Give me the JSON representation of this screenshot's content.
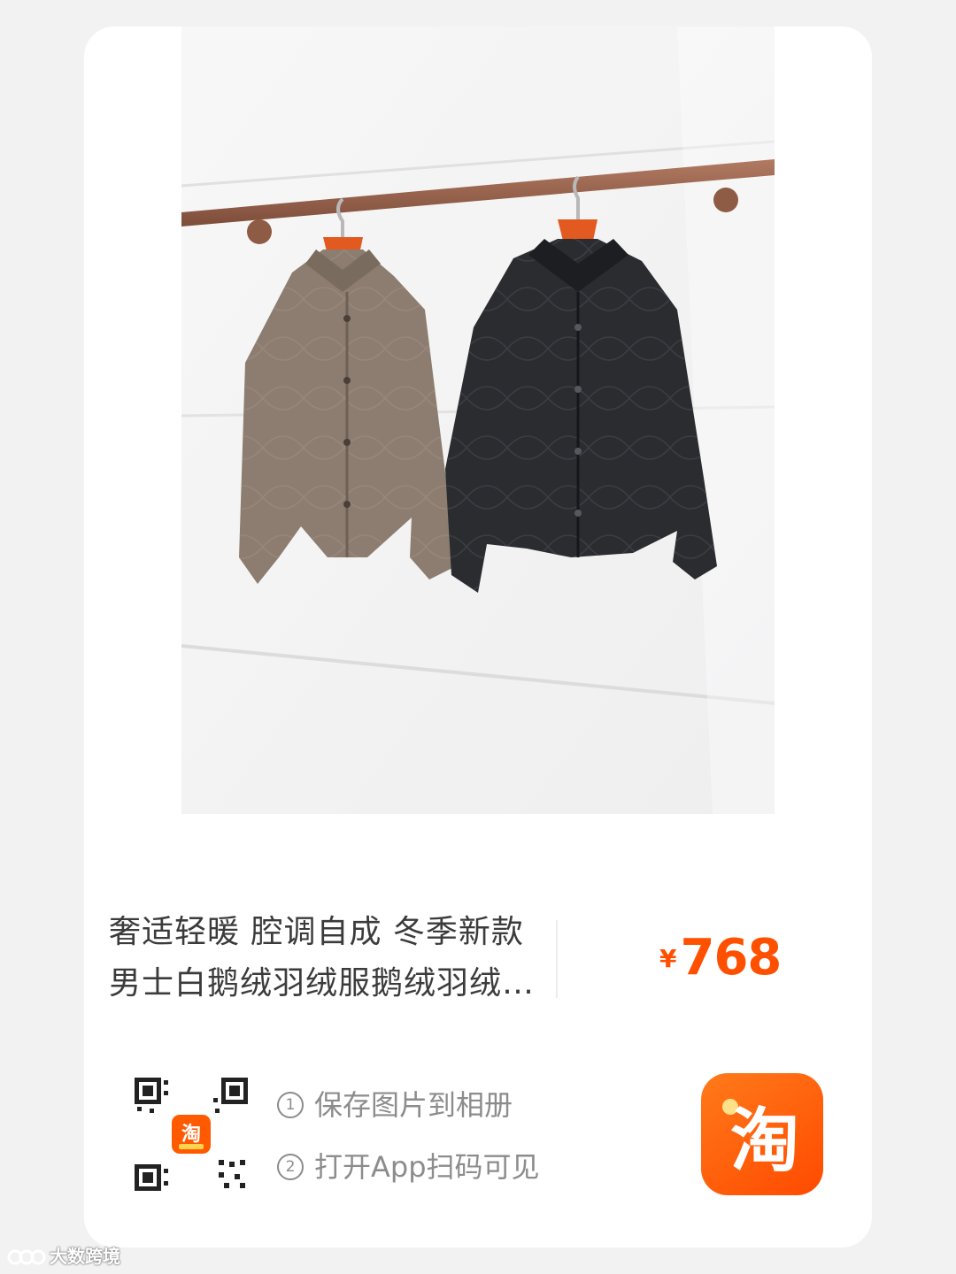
{
  "product": {
    "title": "奢适轻暖 腔调自成 冬季新款男士白鹅绒羽绒服鹅绒羽绒服男",
    "currency_symbol": "¥",
    "price": "768"
  },
  "share": {
    "step1_num": "①",
    "step1_text": "保存图片到相册",
    "step2_num": "②",
    "step2_text": "打开App扫码可见"
  },
  "colors": {
    "price": "#ff5000",
    "logo_orange": "#ff5a00"
  },
  "icons": {
    "qr": "qr-code-icon",
    "app_logo": "taobao-logo-icon"
  },
  "watermark": {
    "text": "大数跨境"
  }
}
